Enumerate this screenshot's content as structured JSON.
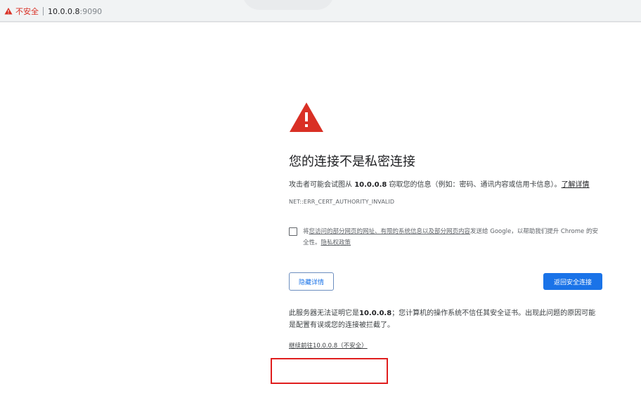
{
  "address_bar": {
    "security_label": "不安全",
    "host": "10.0.0.8",
    "port": ":9090"
  },
  "interstitial": {
    "title": "您的连接不是私密连接",
    "intro_prefix": "攻击者可能会试图从 ",
    "intro_host": "10.0.0.8",
    "intro_suffix": " 窃取您的信息（例如：密码、通讯内容或信用卡信息）。",
    "learn_more": "了解详情",
    "error_code": "NET::ERR_CERT_AUTHORITY_INVALID",
    "optin_prefix": "将",
    "optin_link": "您访问的部分网页的网址、有限的系统信息以及部分网页内容",
    "optin_suffix": "发送给 Google，以帮助我们提升 Chrome 的安全性。",
    "privacy_link": "隐私权政策",
    "hide_details_button": "隐藏详情",
    "back_to_safety_button": "返回安全连接",
    "explain_prefix": "此服务器无法证明它是",
    "explain_host": "10.0.0.8",
    "explain_suffix": "；您计算机的操作系统不信任其安全证书。出现此问题的原因可能是配置有误或您的连接被拦截了。",
    "proceed_link": "继续前往10.0.0.8（不安全）"
  },
  "colors": {
    "warning_red": "#d93025",
    "primary_blue": "#1a73e8",
    "annotation_red": "#e01e1e"
  },
  "icons": {
    "address_warning": "warning-triangle-icon",
    "page_warning": "warning-triangle-icon"
  }
}
